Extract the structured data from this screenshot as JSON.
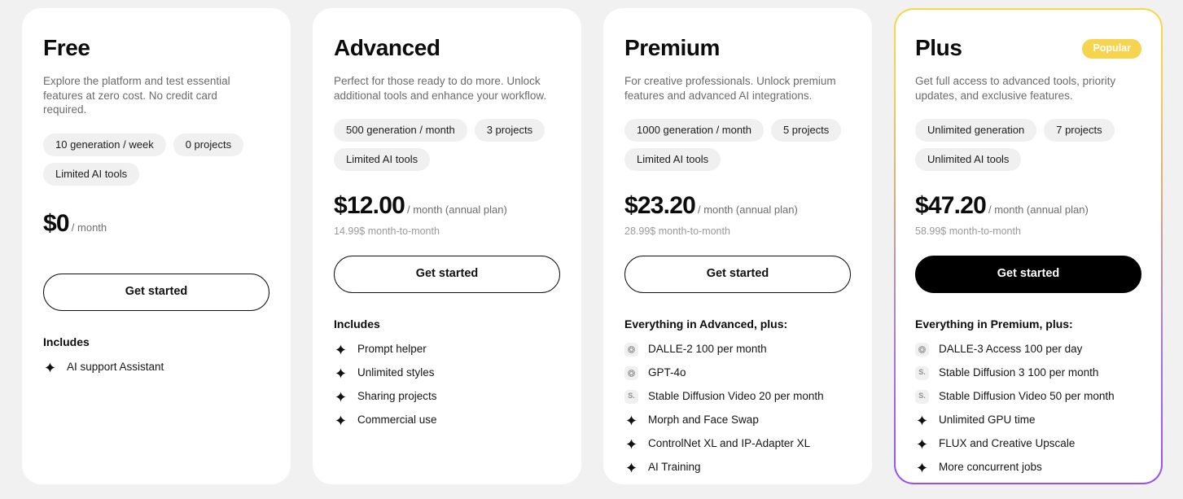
{
  "theme": {
    "page_bg": "#f1f1f1",
    "card_bg": "#ffffff",
    "tag_bg": "#f0f0f0",
    "accent_yellow": "#f6d44f",
    "accent_purple": "#9551f2",
    "cta_solid_bg": "#000000"
  },
  "plans": [
    {
      "id": "free",
      "name": "Free",
      "badge": null,
      "description": "Explore the platform and test essential features at zero cost. No credit card required.",
      "tags": [
        "10 generation / week",
        "0 projects",
        "Limited AI tools"
      ],
      "price_amount": "$0",
      "price_period": "/ month",
      "price_alt": "",
      "cta_label": "Get started",
      "cta_style": "outline",
      "features_title": "Includes",
      "features": [
        {
          "icon": "sparkle-icon",
          "label": "AI support Assistant"
        }
      ]
    },
    {
      "id": "advanced",
      "name": "Advanced",
      "badge": null,
      "description": "Perfect for those ready to do more. Unlock additional tools and enhance your workflow.",
      "tags": [
        "500 generation / month",
        "3 projects",
        "Limited AI tools"
      ],
      "price_amount": "$12.00",
      "price_period": "/ month (annual plan)",
      "price_alt": "14.99$ month-to-month",
      "cta_label": "Get started",
      "cta_style": "outline",
      "features_title": "Includes",
      "features": [
        {
          "icon": "sparkle-icon",
          "label": "Prompt helper"
        },
        {
          "icon": "sparkle-icon",
          "label": "Unlimited styles"
        },
        {
          "icon": "sparkle-icon",
          "label": "Sharing projects"
        },
        {
          "icon": "sparkle-icon",
          "label": "Commercial use"
        }
      ]
    },
    {
      "id": "premium",
      "name": "Premium",
      "badge": null,
      "description": "For creative professionals. Unlock premium features and advanced AI integrations.",
      "tags": [
        "1000 generation / month",
        "5 projects",
        "Limited AI tools"
      ],
      "price_amount": "$23.20",
      "price_period": "/ month (annual plan)",
      "price_alt": "28.99$ month-to-month",
      "cta_label": "Get started",
      "cta_style": "outline",
      "features_title": "Everything in Advanced, plus:",
      "features": [
        {
          "icon": "openai-icon",
          "label": "DALLE-2 100 per month"
        },
        {
          "icon": "openai-icon",
          "label": "GPT-4o"
        },
        {
          "icon": "stability-icon",
          "label": "Stable Diffusion Video 20 per month"
        },
        {
          "icon": "sparkle-icon",
          "label": "Morph and Face Swap"
        },
        {
          "icon": "sparkle-icon",
          "label": "ControlNet XL and IP-Adapter XL"
        },
        {
          "icon": "sparkle-icon",
          "label": "AI Training"
        }
      ]
    },
    {
      "id": "plus",
      "name": "Plus",
      "badge": "Popular",
      "description": "Get full access to advanced tools, priority updates, and exclusive features.",
      "tags": [
        "Unlimited generation",
        "7 projects",
        "Unlimited AI tools"
      ],
      "price_amount": "$47.20",
      "price_period": "/ month (annual plan)",
      "price_alt": "58.99$ month-to-month",
      "cta_label": "Get started",
      "cta_style": "solid",
      "features_title": "Everything in Premium, plus:",
      "features": [
        {
          "icon": "openai-icon",
          "label": "DALLE-3 Access 100 per day"
        },
        {
          "icon": "stability-icon",
          "label": "Stable Diffusion 3 100 per month"
        },
        {
          "icon": "stability-icon",
          "label": "Stable Diffusion Video 50 per month"
        },
        {
          "icon": "sparkle-icon",
          "label": "Unlimited GPU time"
        },
        {
          "icon": "sparkle-icon",
          "label": "FLUX and Creative Upscale"
        },
        {
          "icon": "sparkle-icon",
          "label": "More concurrent jobs"
        }
      ]
    }
  ]
}
